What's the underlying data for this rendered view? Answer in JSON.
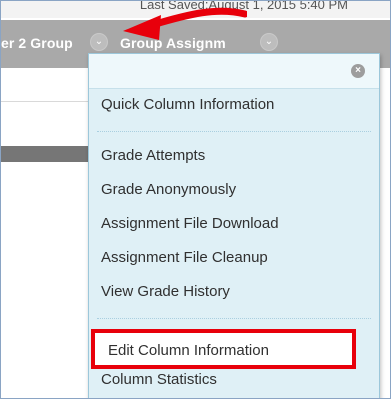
{
  "header": {
    "saved_text": "Last Saved:August 1, 2015 5:40 PM",
    "columns": [
      {
        "label": "er 2 Group"
      },
      {
        "label": "Group Assignm"
      }
    ]
  },
  "menu": {
    "close_icon": "close-icon",
    "items": [
      {
        "label": "Quick Column Information"
      },
      {
        "label": "Grade Attempts"
      },
      {
        "label": "Grade Anonymously"
      },
      {
        "label": "Assignment File Download"
      },
      {
        "label": "Assignment File Cleanup"
      },
      {
        "label": "View Grade History"
      },
      {
        "label": "Edit Column Information"
      },
      {
        "label": "Column Statistics"
      }
    ]
  },
  "annotation": {
    "arrow_color": "#e8000b",
    "highlight_color": "#e8000b"
  }
}
